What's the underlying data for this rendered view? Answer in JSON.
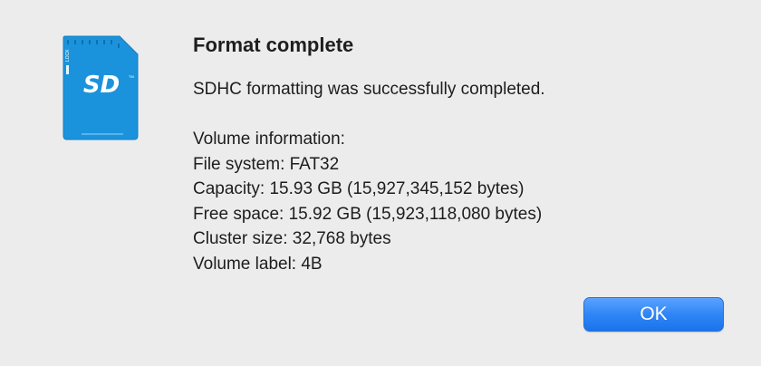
{
  "dialog": {
    "title": "Format complete",
    "message": "SDHC formatting was successfully completed.",
    "info_lines": [
      "Volume information:",
      "File system: FAT32",
      "Capacity: 15.93 GB (15,927,345,152 bytes)",
      "Free space: 15.92 GB (15,923,118,080 bytes)",
      "Cluster size: 32,768 bytes",
      "Volume label: 4B"
    ],
    "ok_label": "OK"
  },
  "icon": {
    "name": "sd-card-icon",
    "card_label": "SD",
    "lock_label": "LOCK",
    "tm_label": "TM",
    "color": "#1b93dc"
  },
  "colors": {
    "background": "#ececec",
    "accent": "#2f86f6"
  }
}
